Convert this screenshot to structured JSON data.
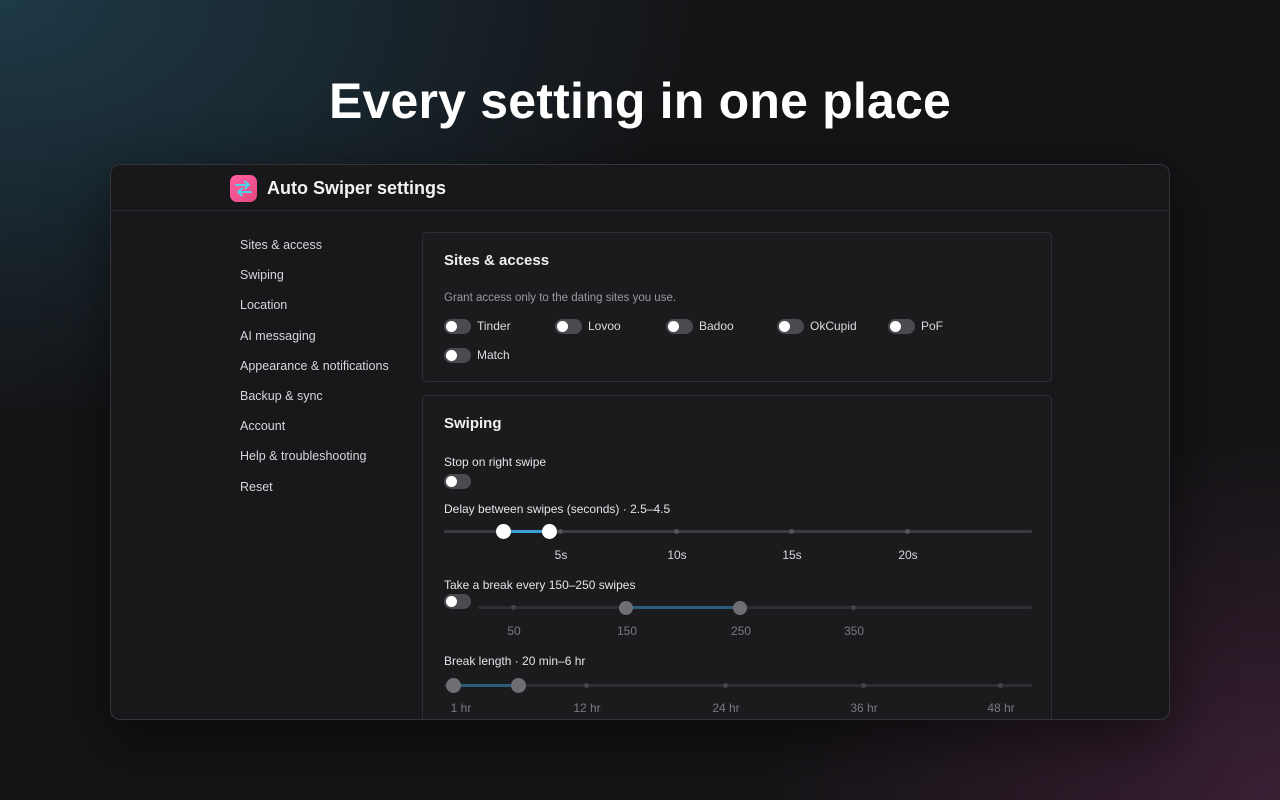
{
  "headline": "Every setting in one place",
  "window": {
    "title": "Auto Swiper settings",
    "icon": "swap-arrows-icon",
    "accent": "#ff5fa2"
  },
  "sidebar": {
    "items": [
      {
        "label": "Sites & access"
      },
      {
        "label": "Swiping"
      },
      {
        "label": "Location"
      },
      {
        "label": "AI messaging"
      },
      {
        "label": "Appearance & notifications"
      },
      {
        "label": "Backup & sync"
      },
      {
        "label": "Account"
      },
      {
        "label": "Help & troubleshooting"
      },
      {
        "label": "Reset"
      }
    ]
  },
  "sites_access": {
    "title": "Sites & access",
    "description": "Grant access only to the dating sites you use.",
    "sites": [
      {
        "label": "Tinder",
        "enabled": false
      },
      {
        "label": "Lovoo",
        "enabled": false
      },
      {
        "label": "Badoo",
        "enabled": false
      },
      {
        "label": "OkCupid",
        "enabled": false
      },
      {
        "label": "PoF",
        "enabled": false
      },
      {
        "label": "Match",
        "enabled": false
      }
    ]
  },
  "swiping": {
    "title": "Swiping",
    "stop_on_right_swipe": {
      "label": "Stop on right swipe",
      "enabled": false
    },
    "delay": {
      "label": "Delay between swipes (seconds) · 2.5–4.5",
      "min": 2.5,
      "max": 4.5,
      "ticks": [
        "5s",
        "10s",
        "15s",
        "20s"
      ],
      "accent": "#3b9fd8"
    },
    "break_every": {
      "label": "Take a break every 150–250 swipes",
      "enabled": false,
      "min": 150,
      "max": 250,
      "ticks": [
        "50",
        "150",
        "250",
        "350"
      ]
    },
    "break_length": {
      "label": "Break length · 20 min–6 hr",
      "ticks": [
        "1 hr",
        "12 hr",
        "24 hr",
        "36 hr",
        "48 hr"
      ]
    }
  }
}
